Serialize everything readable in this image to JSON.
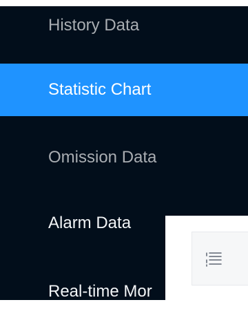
{
  "sidebar": {
    "items": [
      {
        "label": "History Data",
        "active": false
      },
      {
        "label": "Statistic Chart",
        "active": true
      },
      {
        "label": "Omission Data",
        "active": false
      },
      {
        "label": "Alarm Data",
        "active": false
      },
      {
        "label": "Real-time Mor",
        "active": false
      }
    ]
  },
  "toolbar": {
    "menu_toggle_icon": "list-icon"
  },
  "colors": {
    "sidebar_bg": "#020e1b",
    "active_bg": "#1f93ff",
    "muted_text": "#a9adb2",
    "light_text": "#f2f4f6"
  }
}
